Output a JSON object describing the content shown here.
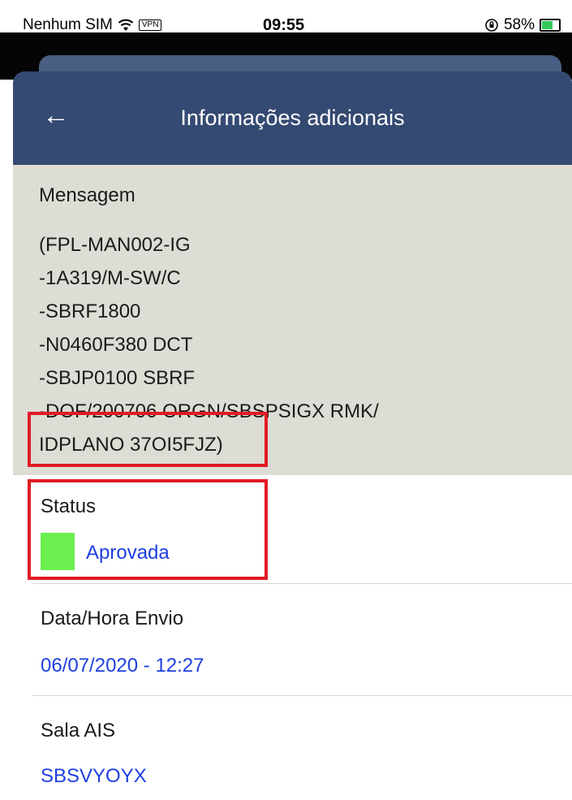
{
  "status_bar": {
    "carrier": "Nenhum SIM",
    "vpn": "VPN",
    "time": "09:55",
    "battery": "58%"
  },
  "header": {
    "title": "Informações adicionais",
    "back_icon": "back-arrow-icon"
  },
  "message": {
    "label": "Mensagem",
    "lines": [
      "(FPL-MAN002-IG",
      "-1A319/M-SW/C",
      "-SBRF1800",
      "-N0460F380 DCT",
      "-SBJP0100 SBRF",
      "-DOF/200706 ORGN/SBSPSIGX RMK/",
      "IDPLANO 37OI5FJZ)"
    ]
  },
  "status": {
    "label": "Status",
    "value": "Aprovada",
    "color": "#6bf050"
  },
  "sent": {
    "label": "Data/Hora Envio",
    "value": "06/07/2020 - 12:27"
  },
  "room": {
    "label": "Sala AIS",
    "value": "SBSVYOYX"
  },
  "colors": {
    "header_bg": "#344a72",
    "message_bg": "#dddcd5",
    "value_text": "#1d3fe0",
    "highlight": "#e01b24"
  }
}
